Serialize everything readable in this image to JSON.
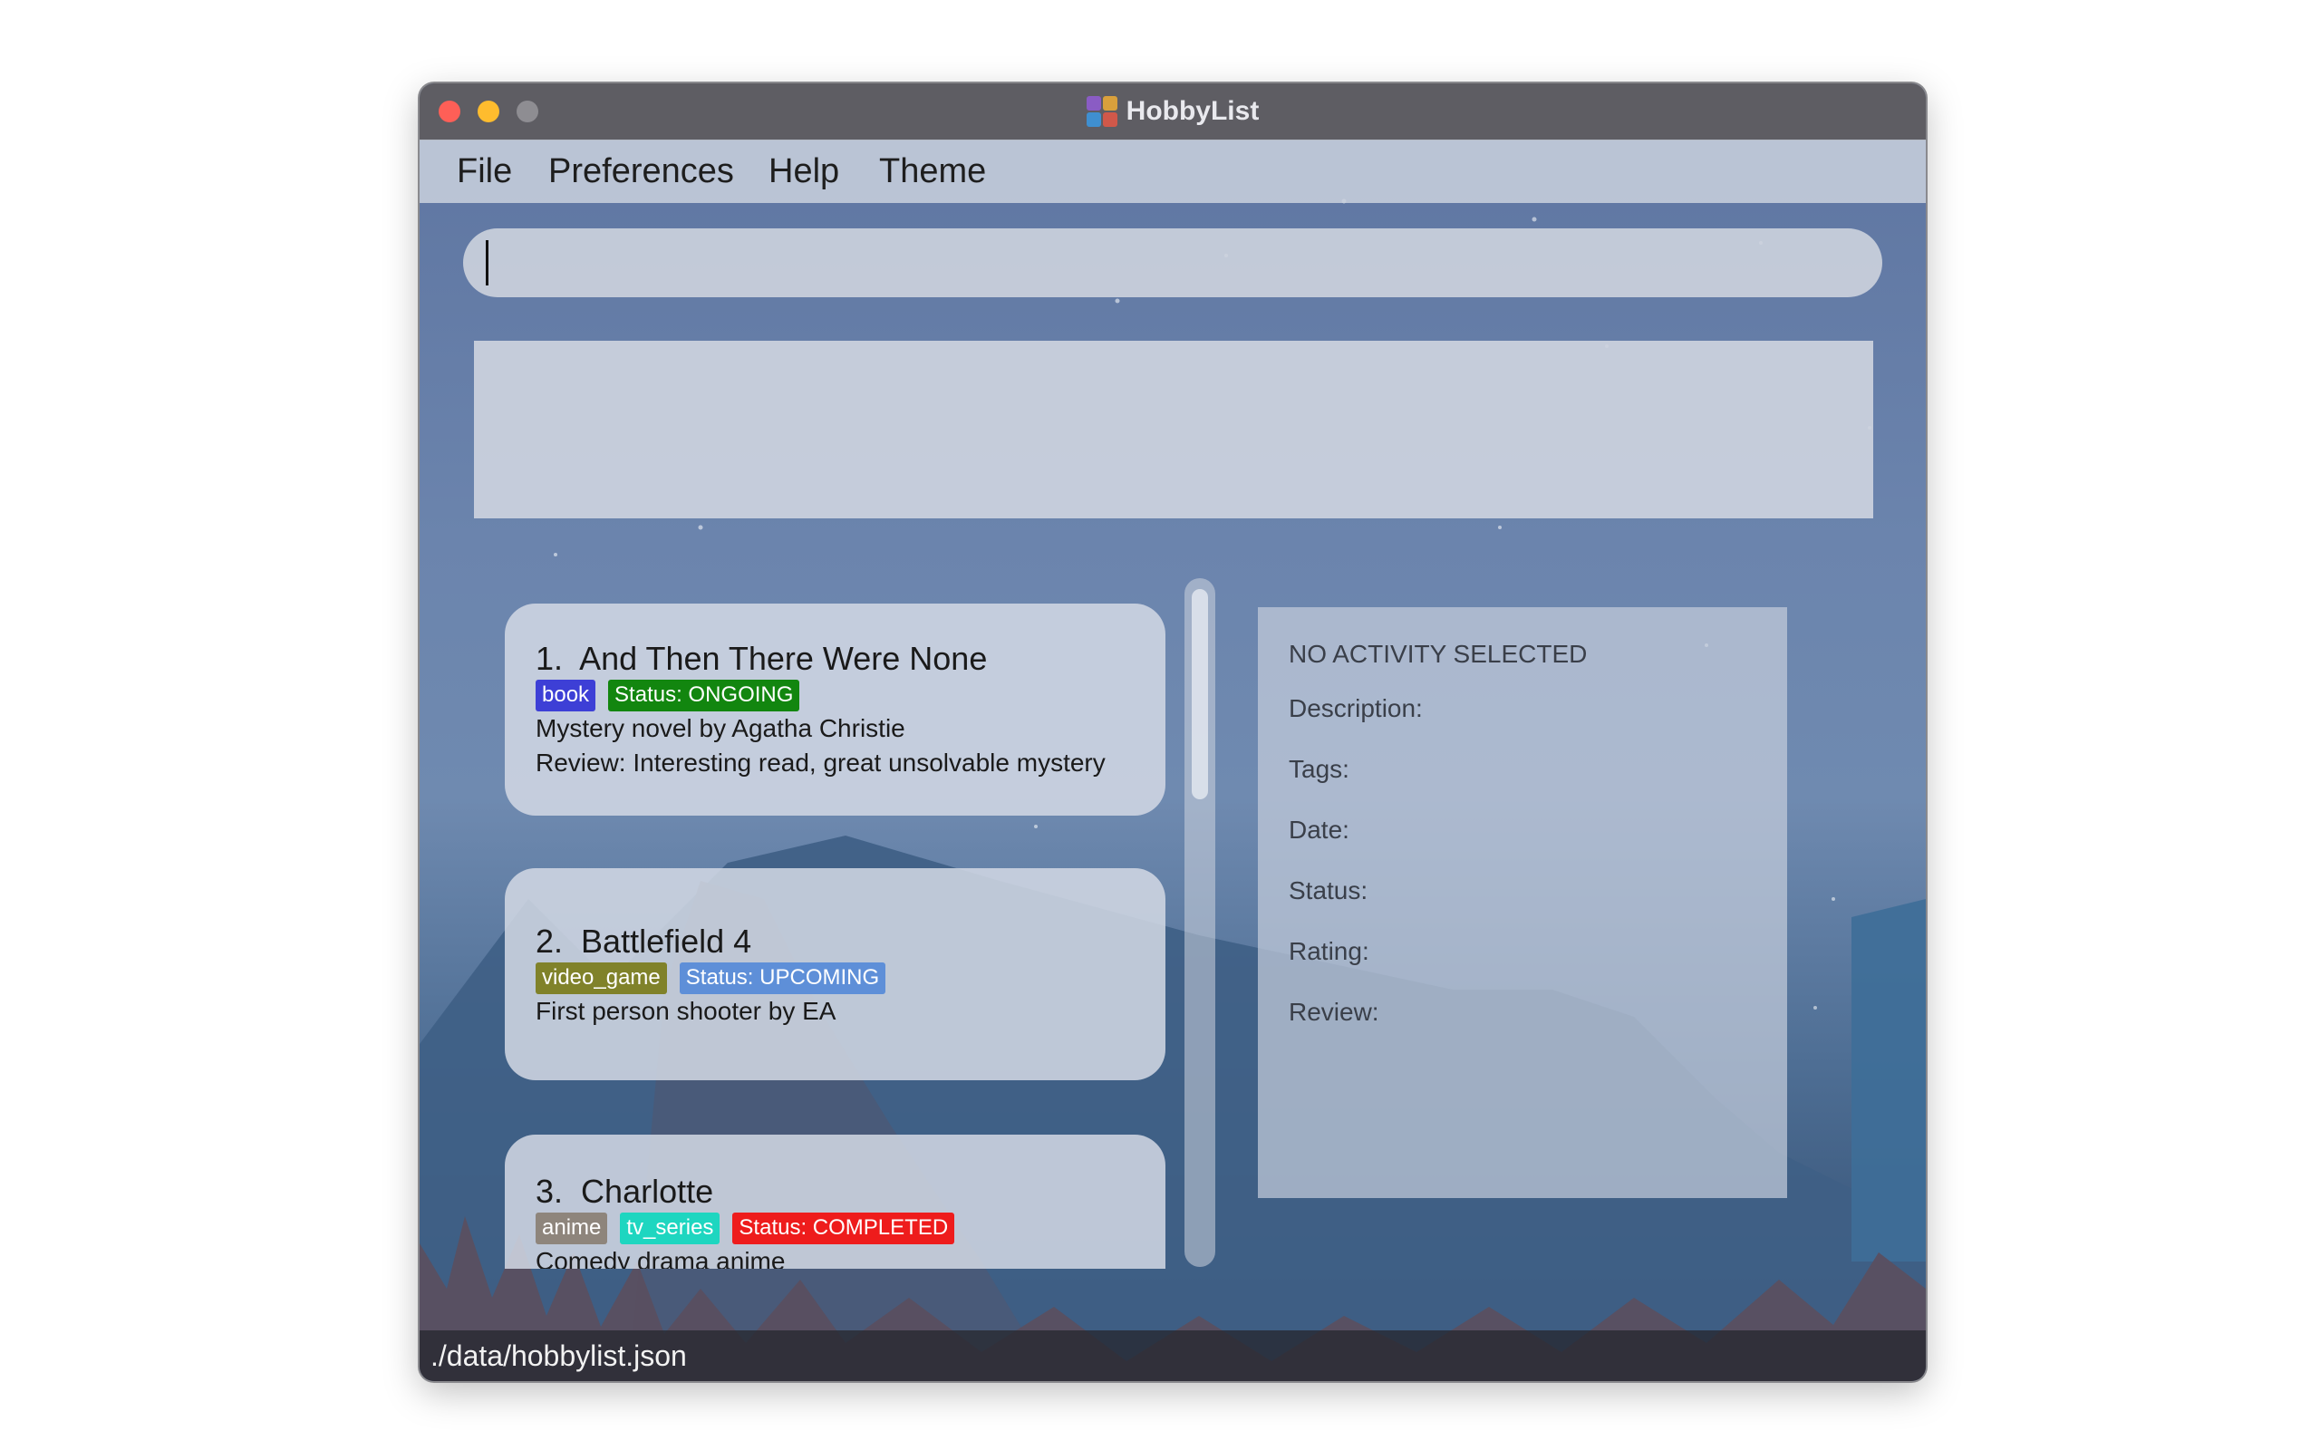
{
  "window": {
    "title": "HobbyList"
  },
  "menu": [
    "File",
    "Preferences",
    "Help",
    "Theme"
  ],
  "command_box": {
    "value": ""
  },
  "result_display": {
    "text": ""
  },
  "activities": [
    {
      "index": "1.",
      "name": "And Then There Were None",
      "tags": [
        {
          "label": "book",
          "color": "#3d3fd6"
        },
        {
          "label": "Status: ONGOING",
          "color": "#12860f"
        }
      ],
      "description": "Mystery novel by Agatha Christie",
      "review": "Review: Interesting read, great unsolvable mystery"
    },
    {
      "index": "2.",
      "name": "Battlefield 4",
      "tags": [
        {
          "label": "video_game",
          "color": "#80822a"
        },
        {
          "label": "Status: UPCOMING",
          "color": "#5e8fd8"
        }
      ],
      "description": "First person shooter by EA",
      "review": ""
    },
    {
      "index": "3.",
      "name": "Charlotte",
      "tags": [
        {
          "label": "anime",
          "color": "#8e857c"
        },
        {
          "label": "tv_series",
          "color": "#1ed6c0"
        },
        {
          "label": "Status: COMPLETED",
          "color": "#ee1c1c"
        }
      ],
      "description": "Comedy drama anime",
      "review": ""
    }
  ],
  "detail_panel": {
    "heading": "NO ACTIVITY SELECTED",
    "fields": [
      "Description:",
      "Tags:",
      "Date:",
      "Status:",
      "Rating:",
      "Review:"
    ]
  },
  "status_bar": {
    "path": "./data/hobbylist.json"
  }
}
